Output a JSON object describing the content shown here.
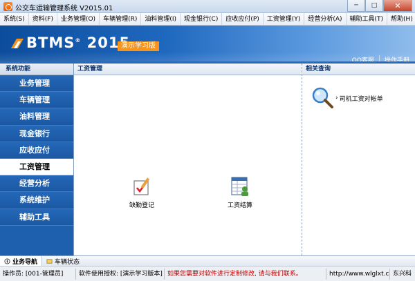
{
  "window": {
    "title": "公交车运输管理系统 V2015.01",
    "min_label": "─",
    "max_label": "□",
    "close_label": "✕"
  },
  "menu": {
    "items": [
      "系统(S)",
      "资料(F)",
      "业务管理(O)",
      "车辆管理(R)",
      "油料管理(I)",
      "现金银行(C)",
      "应收应付(P)",
      "工资管理(Y)",
      "经营分析(A)",
      "辅助工具(T)",
      "帮助(H)"
    ]
  },
  "banner": {
    "logo_text": "BTMS",
    "logo_reg": "®",
    "logo_year": "2015",
    "badge": "演示学习版",
    "links": {
      "qq": "QQ客服",
      "sep": "|",
      "manual": "操作手册"
    }
  },
  "sidebar": {
    "title": "系统功能",
    "items": [
      "业务管理",
      "车辆管理",
      "油料管理",
      "现金银行",
      "应收应付",
      "工资管理",
      "经营分析",
      "系统维护",
      "辅助工具"
    ],
    "active": "工资管理"
  },
  "main": {
    "title": "工资管理",
    "tiles": {
      "attendance": "缺勤登记",
      "settlement": "工资结算"
    }
  },
  "related": {
    "title": "相关查询",
    "link": "司机工资对帐单"
  },
  "bottom_tabs": {
    "nav": "业务导航",
    "vehicle": "车辆状态"
  },
  "status": {
    "operator": "操作员: [001-管理员]",
    "license": "软件使用授权: [演示学习版本]",
    "notice": "如果您需要对软件进行定制修改, 请与我们联系。",
    "url": "http://www.wlglxt.com",
    "company": "东兴科"
  },
  "colors": {
    "sidebar_bg": "#1e5fae",
    "banner_left": "#0c4c9c",
    "badge": "#f7941d",
    "notice": "#c00000"
  }
}
